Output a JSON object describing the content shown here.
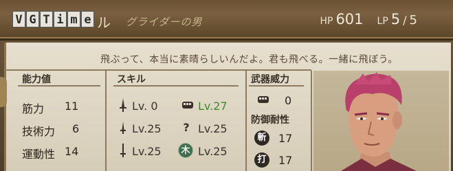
{
  "header": {
    "logo_letters": [
      "V",
      "G",
      "T",
      "i",
      "m",
      "e"
    ],
    "name_suffix": "ル",
    "title": "グライダーの男",
    "hp_label": "HP",
    "hp_value": "601",
    "lp_label": "LP",
    "lp_current": "5",
    "lp_slash": "/",
    "lp_max": "5"
  },
  "dialogue": "飛ぶって、本当に素晴らしいんだよ。君も飛べる。一緒に飛ぼう。",
  "stats": {
    "heading": "能力値",
    "rows": [
      {
        "label": "筋力",
        "value": "11"
      },
      {
        "label": "技術力",
        "value": "6"
      },
      {
        "label": "運動性",
        "value": "14"
      }
    ]
  },
  "skills": {
    "heading": "スキル",
    "rows": [
      {
        "left_icon": "sword-icon",
        "left_lv": "Lv. 0",
        "right_icon": "fist-icon",
        "right_lv": "Lv.27",
        "right_green": true
      },
      {
        "left_icon": "dagger-icon",
        "left_lv": "Lv.25",
        "right_icon": "question-icon",
        "right_lv": "Lv.25",
        "right_green": false
      },
      {
        "left_icon": "rapier-icon",
        "left_lv": "Lv.25",
        "right_icon": "wood-kanji-icon",
        "right_lv": "Lv.25",
        "right_green": false
      }
    ],
    "right_icon_text": [
      "",
      "?",
      "木"
    ]
  },
  "weapon": {
    "heading": "武器威力",
    "value": "0",
    "defense_heading": "防御耐性",
    "defense": [
      {
        "kanji": "斬",
        "value": "17"
      },
      {
        "kanji": "打",
        "value": "17"
      }
    ]
  },
  "colors": {
    "level_green": "#3e8a2e",
    "parchment": "#e0d8c6",
    "header_brown": "#6a5232"
  }
}
